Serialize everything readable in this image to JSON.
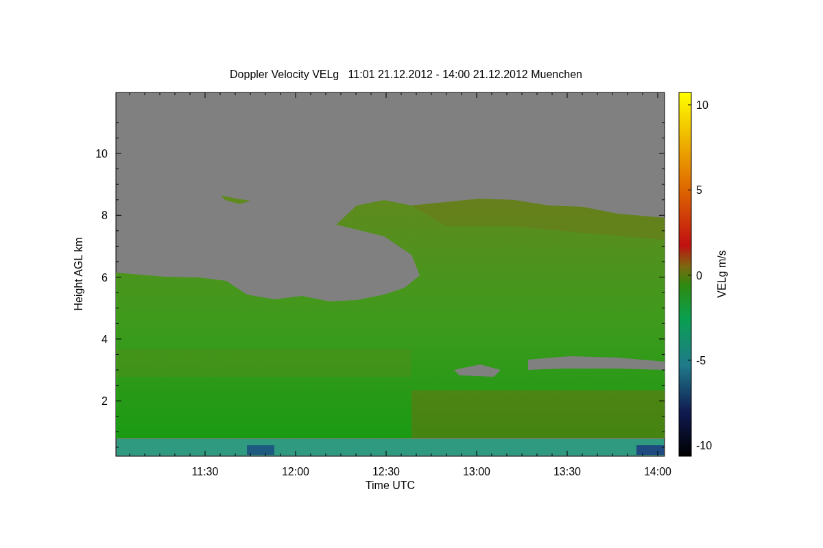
{
  "chart": {
    "title": "Doppler Velocity VELg   11:01 21.12.2012 - 14:00 21.12.2012 Muenchen",
    "ylabel": "Height AGL km",
    "xlabel": "Time UTC",
    "yticks": [
      "10",
      "8",
      "6",
      "4",
      "2"
    ],
    "xticks": [
      "11:30",
      "12:00",
      "12:30",
      "13:00",
      "13:30",
      "14:00"
    ],
    "colorbar": {
      "label": "VELg m/s",
      "ticks": [
        "10",
        "5",
        "0",
        "-5",
        "-10"
      ]
    }
  }
}
